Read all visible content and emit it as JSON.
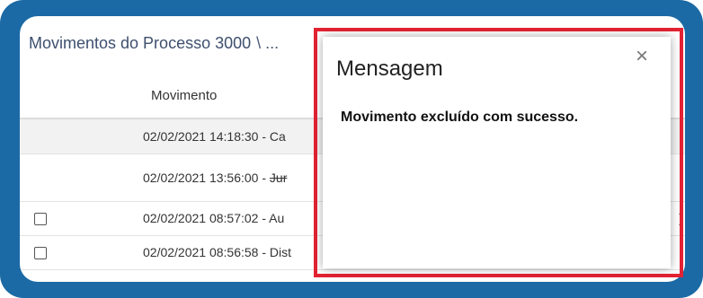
{
  "page": {
    "title": "Movimentos do Processo 3000",
    "title_obscured": "\\ ...",
    "column_header": "Movimento"
  },
  "rows": [
    {
      "text": "02/02/2021 14:18:30 - Ca",
      "checkbox": false,
      "strike": false
    },
    {
      "text": "02/02/2021 13:56:00 - ",
      "strike_text": "Jur",
      "checkbox": false,
      "strike": true
    },
    {
      "text": "02/02/2021 08:57:02 - Au",
      "checkbox": true,
      "strike": false
    },
    {
      "text": "02/02/2021 08:56:58 - Dist",
      "checkbox": true,
      "strike": false
    }
  ],
  "right_glyph": ")",
  "modal": {
    "title": "Mensagem",
    "close_label": "×",
    "message": "Movimento excluído com sucesso."
  },
  "colors": {
    "frame": "#1b6aa5",
    "highlight": "#e32232"
  }
}
